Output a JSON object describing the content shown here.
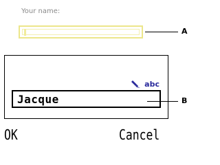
{
  "form": {
    "label": "Your name:",
    "field_value": ""
  },
  "callouts": {
    "a": "A",
    "b": "B"
  },
  "dialog": {
    "mode_icon": "pen-icon",
    "mode_label": "abc",
    "input_value": "Jacque"
  },
  "softkeys": {
    "left": "OK",
    "right": "Cancel"
  },
  "colors": {
    "highlight": "#ece68a",
    "mode_accent": "#2a2a9c"
  }
}
